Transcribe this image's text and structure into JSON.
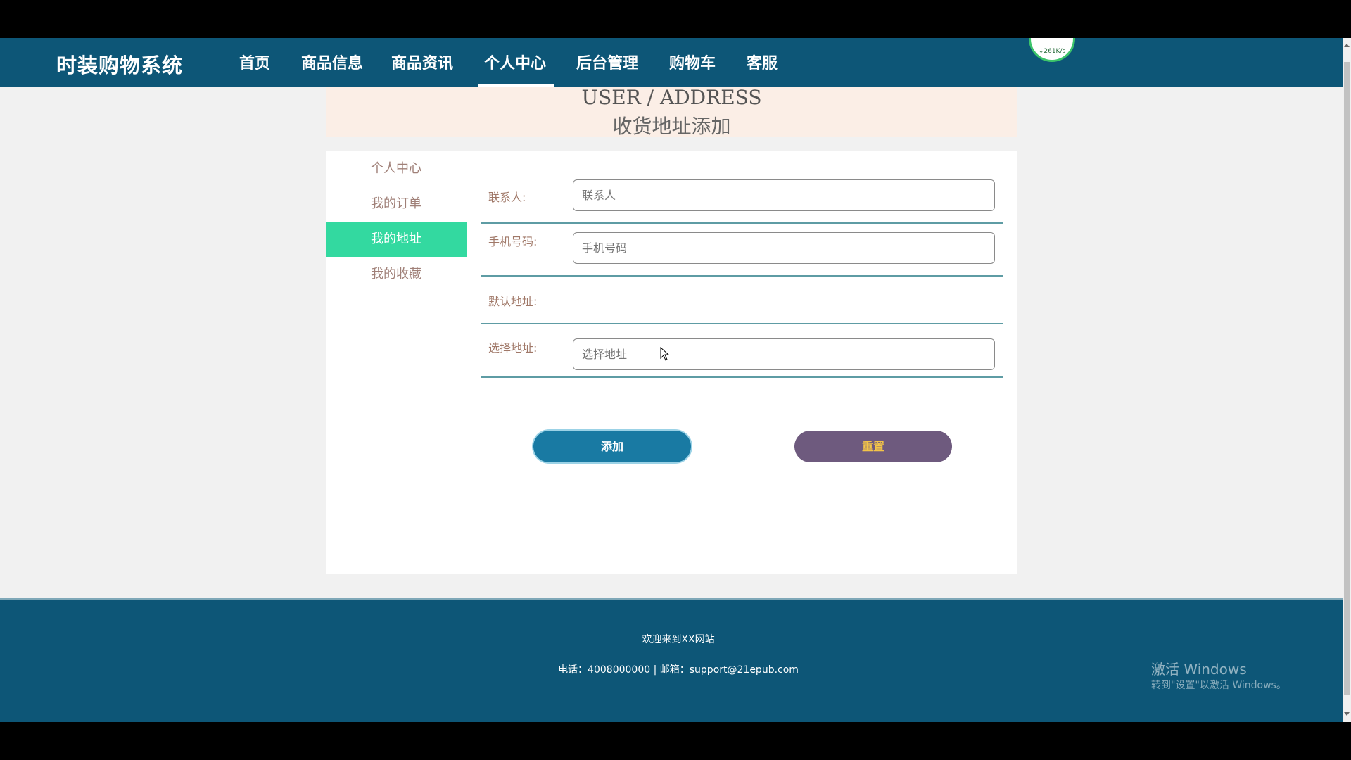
{
  "nav": {
    "brand": "时装购物系统",
    "items": [
      {
        "label": "首页"
      },
      {
        "label": "商品信息"
      },
      {
        "label": "商品资讯"
      },
      {
        "label": "个人中心",
        "active": true
      },
      {
        "label": "后台管理"
      },
      {
        "label": "购物车"
      },
      {
        "label": "客服"
      }
    ],
    "speed_widget": "↓261K/s"
  },
  "banner": {
    "title_en": "USER / ADDRESS",
    "title_cn": "收货地址添加"
  },
  "sidebar": {
    "items": [
      {
        "label": "个人中心"
      },
      {
        "label": "我的订单"
      },
      {
        "label": "我的地址",
        "active": true
      },
      {
        "label": "我的收藏"
      }
    ]
  },
  "form": {
    "contact": {
      "label": "联系人:",
      "placeholder": "联系人",
      "value": ""
    },
    "phone": {
      "label": "手机号码:",
      "placeholder": "手机号码",
      "value": ""
    },
    "default_address": {
      "label": "默认地址:"
    },
    "select_address": {
      "label": "选择地址:",
      "placeholder": "选择地址",
      "value": ""
    },
    "add_button": "添加",
    "reset_button": "重置"
  },
  "footer": {
    "welcome": "欢迎来到XX网站",
    "contact": "电话：4008000000 | 邮箱：support@21epub.com"
  },
  "watermark": {
    "title": "激活 Windows",
    "subtitle": "转到\"设置\"以激活 Windows。"
  },
  "colors": {
    "nav_bg": "#0d5677",
    "sidebar_active": "#33d9a0",
    "add_button": "#197aa3",
    "reset_button": "#6e5a7e",
    "reset_text": "#f3c448",
    "banner_bg": "#fbeee6"
  }
}
